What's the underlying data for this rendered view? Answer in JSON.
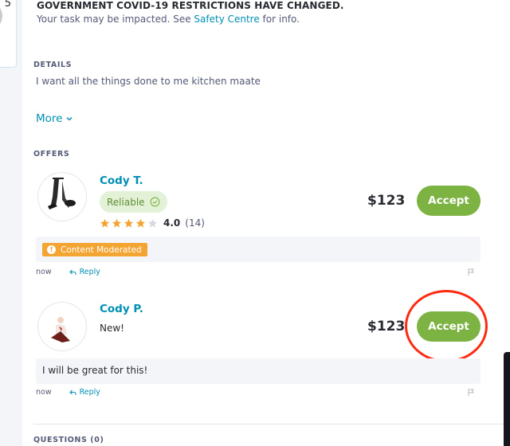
{
  "left_panel": {
    "digit": "5"
  },
  "notice": {
    "title": "GOVERNMENT COVID-19 RESTRICTIONS HAVE CHANGED.",
    "text_before": "Your task may be impacted. See ",
    "link": "Safety Centre",
    "text_after": " for info."
  },
  "details": {
    "label": "DETAILS",
    "text": "I want all the things done to me kitchen maate",
    "more_label": "More"
  },
  "offers": {
    "label": "OFFERS",
    "items": [
      {
        "name": "Cody T.",
        "badge": "Reliable",
        "rating_value": "4.0",
        "rating_count": "(14)",
        "rating_stars": 4,
        "price": "$123",
        "accept_label": "Accept",
        "moderated_label": "Content Moderated",
        "time": "now",
        "reply_label": "Reply"
      },
      {
        "name": "Cody P.",
        "status": "New!",
        "price": "$123",
        "accept_label": "Accept",
        "comment": "I will be great for this!",
        "time": "now",
        "reply_label": "Reply"
      }
    ]
  },
  "questions": {
    "label": "QUESTIONS (0)"
  },
  "colors": {
    "accent_link": "#008fb4",
    "accept_green": "#7db343",
    "moderated_orange": "#f3a431",
    "highlight_red": "#ff2a12"
  }
}
